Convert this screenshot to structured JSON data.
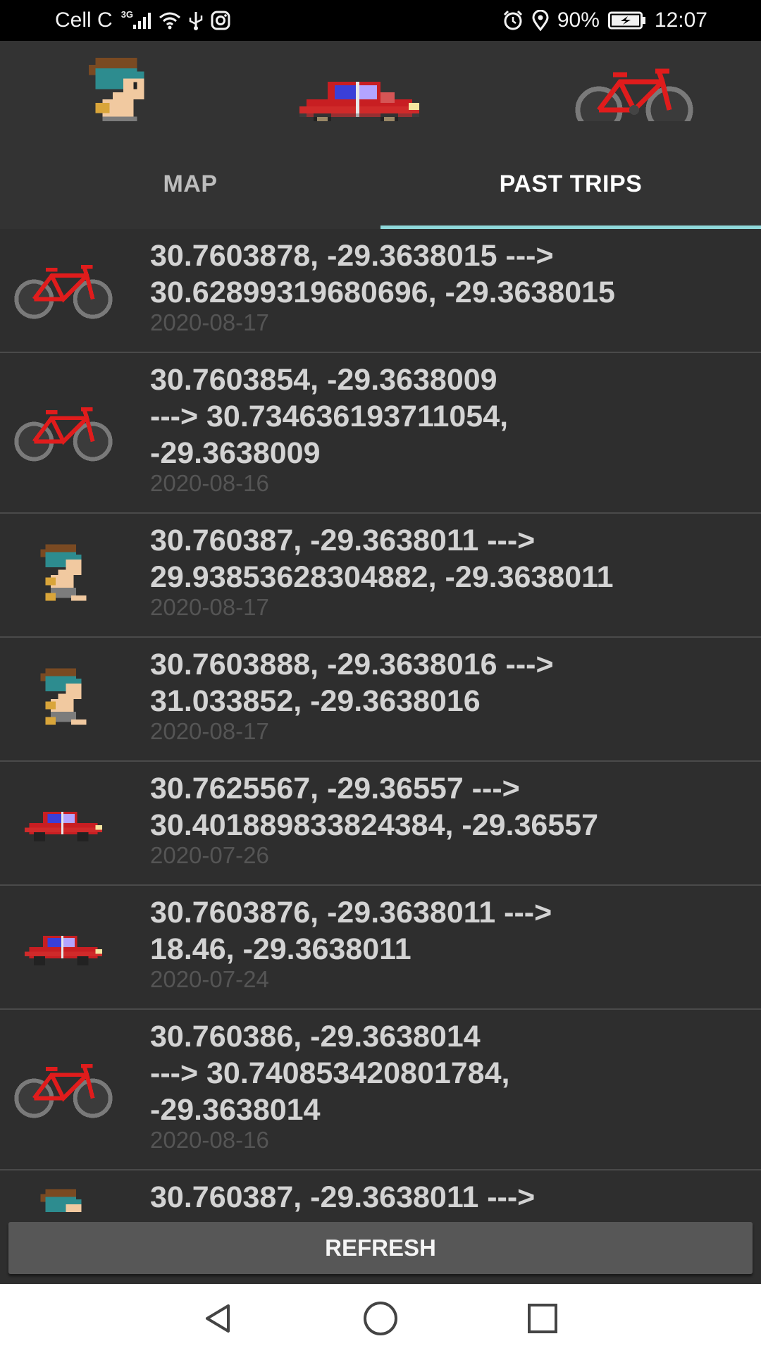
{
  "status_bar": {
    "carrier": "Cell C",
    "network_type": "3G",
    "battery_percent": "90%",
    "time": "12:07",
    "icons": [
      "signal-icon",
      "wifi-icon",
      "usb-icon",
      "instagram-icon",
      "alarm-icon",
      "location-icon",
      "battery-icon"
    ]
  },
  "mode_selector": {
    "modes": [
      {
        "name": "walk",
        "icon": "walking-person-icon"
      },
      {
        "name": "car",
        "icon": "car-icon"
      },
      {
        "name": "bike",
        "icon": "bicycle-icon"
      }
    ]
  },
  "tabs": {
    "map_label": "MAP",
    "past_trips_label": "PAST TRIPS",
    "selected": "PAST TRIPS",
    "indicator_color": "#8fd8da"
  },
  "trips": [
    {
      "mode": "bicycle-icon",
      "route": "30.7603878, -29.3638015 --->\n30.62899319680696, -29.3638015",
      "date": "2020-08-17"
    },
    {
      "mode": "bicycle-icon",
      "route": "30.7603854, -29.3638009\n---> 30.734636193711054,\n-29.3638009",
      "date": "2020-08-16"
    },
    {
      "mode": "walking-person-icon",
      "route": "30.760387, -29.3638011 --->\n29.93853628304882, -29.3638011",
      "date": "2020-08-17"
    },
    {
      "mode": "walking-person-icon",
      "route": "30.7603888, -29.3638016 --->\n31.033852, -29.3638016",
      "date": "2020-08-17"
    },
    {
      "mode": "car-icon",
      "route": "30.7625567, -29.36557 --->\n30.401889833824384, -29.36557",
      "date": "2020-07-26"
    },
    {
      "mode": "car-icon",
      "route": "30.7603876, -29.3638011 --->\n18.46, -29.3638011",
      "date": "2020-07-24"
    },
    {
      "mode": "bicycle-icon",
      "route": "30.760386, -29.3638014\n---> 30.740853420801784,\n-29.3638014",
      "date": "2020-08-16"
    },
    {
      "mode": "walking-person-icon",
      "route": "30.760387, -29.3638011 --->",
      "date": ""
    }
  ],
  "refresh_label": "REFRESH",
  "nav": {
    "back": "back-icon",
    "home": "home-icon",
    "recents": "recents-icon"
  }
}
